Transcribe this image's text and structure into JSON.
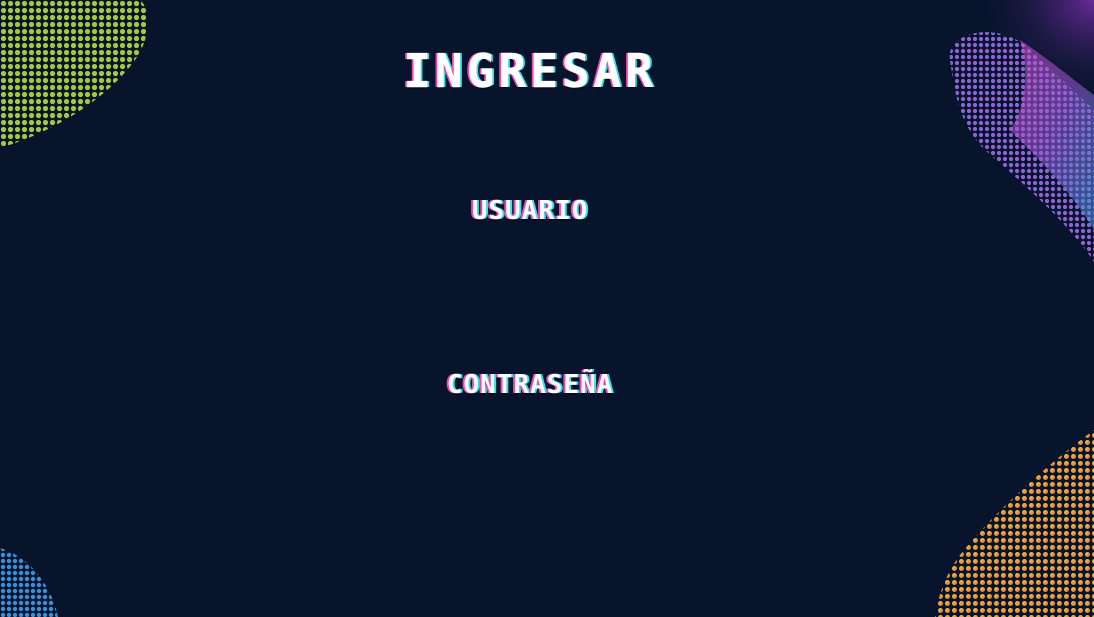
{
  "page": {
    "title": "INGRESAR"
  },
  "form": {
    "username_label": "USUARIO",
    "username_value": "",
    "password_label": "CONTRASEÑA",
    "password_value": ""
  },
  "colors": {
    "background": "#07142c",
    "text": "#ffffff",
    "glitch_pink": "#ff3fa8",
    "glitch_cyan": "#28e6f0",
    "decor_green": "#a8c83a",
    "decor_purple": "#7a3fb0",
    "decor_blue": "#3a8fd8",
    "decor_orange": "#e89a3a"
  }
}
